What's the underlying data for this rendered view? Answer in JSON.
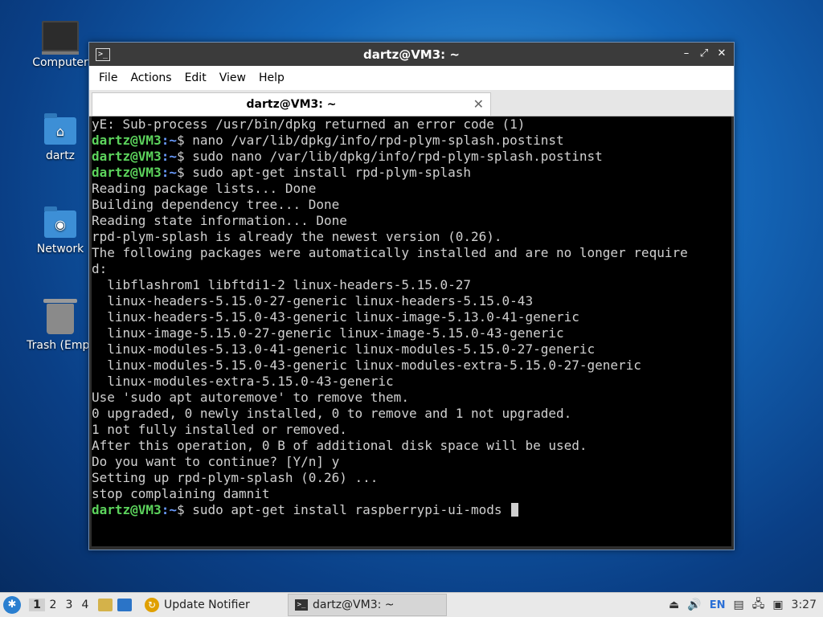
{
  "desktop": {
    "icons": [
      {
        "label": "Computer",
        "icon": "computer-icon"
      },
      {
        "label": "dartz",
        "icon": "home-folder-icon"
      },
      {
        "label": "Network",
        "icon": "network-folder-icon"
      },
      {
        "label": "Trash (Empt",
        "icon": "trash-icon"
      }
    ]
  },
  "window": {
    "title": "dartz@VM3: ~",
    "menu": [
      "File",
      "Edit",
      "View",
      "Help"
    ],
    "menu_actions": "Actions",
    "tab_title": "dartz@VM3: ~",
    "prompt_user": "dartz@VM3",
    "prompt_path": ":~",
    "lines": [
      {
        "type": "out",
        "text": "yE: Sub-process /usr/bin/dpkg returned an error code (1)"
      },
      {
        "type": "cmd",
        "text": "$ nano /var/lib/dpkg/info/rpd-plym-splash.postinst"
      },
      {
        "type": "cmd",
        "text": "$ sudo nano /var/lib/dpkg/info/rpd-plym-splash.postinst"
      },
      {
        "type": "cmd",
        "text": "$ sudo apt-get install rpd-plym-splash"
      },
      {
        "type": "out",
        "text": "Reading package lists... Done"
      },
      {
        "type": "out",
        "text": "Building dependency tree... Done"
      },
      {
        "type": "out",
        "text": "Reading state information... Done"
      },
      {
        "type": "out",
        "text": "rpd-plym-splash is already the newest version (0.26)."
      },
      {
        "type": "out",
        "text": "The following packages were automatically installed and are no longer require"
      },
      {
        "type": "out",
        "text": "d:"
      },
      {
        "type": "out",
        "text": "  libflashrom1 libftdi1-2 linux-headers-5.15.0-27"
      },
      {
        "type": "out",
        "text": "  linux-headers-5.15.0-27-generic linux-headers-5.15.0-43"
      },
      {
        "type": "out",
        "text": "  linux-headers-5.15.0-43-generic linux-image-5.13.0-41-generic"
      },
      {
        "type": "out",
        "text": "  linux-image-5.15.0-27-generic linux-image-5.15.0-43-generic"
      },
      {
        "type": "out",
        "text": "  linux-modules-5.13.0-41-generic linux-modules-5.15.0-27-generic"
      },
      {
        "type": "out",
        "text": "  linux-modules-5.15.0-43-generic linux-modules-extra-5.15.0-27-generic"
      },
      {
        "type": "out",
        "text": "  linux-modules-extra-5.15.0-43-generic"
      },
      {
        "type": "out",
        "text": "Use 'sudo apt autoremove' to remove them."
      },
      {
        "type": "out",
        "text": "0 upgraded, 0 newly installed, 0 to remove and 1 not upgraded."
      },
      {
        "type": "out",
        "text": "1 not fully installed or removed."
      },
      {
        "type": "out",
        "text": "After this operation, 0 B of additional disk space will be used."
      },
      {
        "type": "out",
        "text": "Do you want to continue? [Y/n] y"
      },
      {
        "type": "out",
        "text": "Setting up rpd-plym-splash (0.26) ..."
      },
      {
        "type": "out",
        "text": "stop complaining damnit"
      },
      {
        "type": "cur",
        "text": "$ sudo apt-get install raspberrypi-ui-mods "
      }
    ]
  },
  "taskbar": {
    "workspaces": [
      "1",
      "2",
      "3",
      "4"
    ],
    "tasks": [
      {
        "label": "Update Notifier",
        "icon": "update-notifier-icon"
      },
      {
        "label": "dartz@VM3: ~",
        "icon": "terminal-icon"
      }
    ],
    "lang": "EN",
    "clock": "3:27"
  }
}
